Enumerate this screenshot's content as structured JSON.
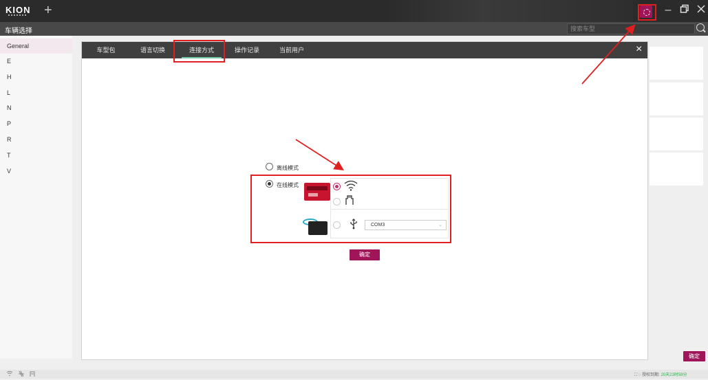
{
  "app": {
    "logo": "KION",
    "new_tab_symbol": "+"
  },
  "header": {
    "title": "车辆选择",
    "search_placeholder": "搜索车型"
  },
  "sidebar": {
    "items": [
      "General",
      "E",
      "H",
      "L",
      "N",
      "P",
      "R",
      "T",
      "V"
    ]
  },
  "modal": {
    "tabs": [
      "车型包",
      "语言切换",
      "连接方式",
      "操作记录",
      "当前用户"
    ],
    "active_tab": "连接方式",
    "close_symbol": "×",
    "offline_label": "离线模式",
    "online_label": "在线模式",
    "com_port": "COM3",
    "confirm_label": "确定"
  },
  "footer": {
    "confirm_label": "确定",
    "license_label": "授权到期:",
    "license_value": "20天23时59分"
  },
  "colors": {
    "accent": "#a0145a",
    "annotation": "#e02020",
    "active_tab_underline": "#6fc3a0"
  }
}
